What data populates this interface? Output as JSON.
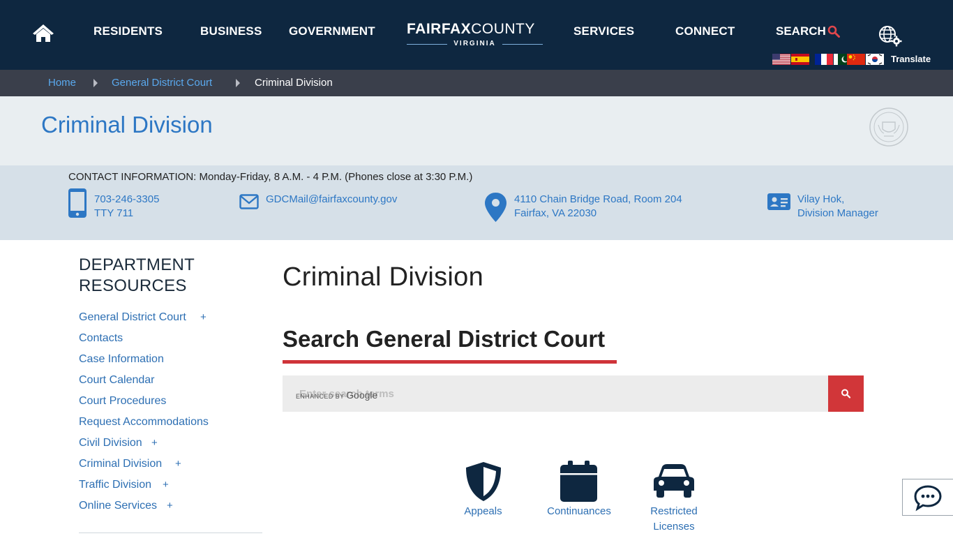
{
  "nav": {
    "residents": "RESIDENTS",
    "business": "BUSINESS",
    "government": "GOVERNMENT",
    "logo_bold": "FAIRFAX",
    "logo_light": "COUNTY",
    "logo_sub": "VIRGINIA",
    "services": "SERVICES",
    "connect": "CONNECT",
    "search": "SEARCH",
    "translate": "Translate"
  },
  "breadcrumb": {
    "home": "Home",
    "parent": "General District Court",
    "current": "Criminal Division"
  },
  "page_heading": "Criminal Division",
  "contact": {
    "hours": "CONTACT INFORMATION: Monday-Friday, 8 A.M. - 4 P.M. (Phones close at 3:30 P.M.)",
    "phone": "703-246-3305",
    "tty": "TTY 711",
    "email": "GDCMail@fairfaxcounty.gov",
    "address_line1": "4110 Chain Bridge Road, Room 204",
    "address_line2": "Fairfax, VA 22030",
    "manager_name": "Vilay Hok,",
    "manager_title": "Division Manager"
  },
  "sidebar": {
    "title": "DEPARTMENT RESOURCES",
    "items": [
      {
        "label": "General District Court",
        "expandable": "+"
      },
      {
        "label": "Contacts",
        "expandable": ""
      },
      {
        "label": "Case Information",
        "expandable": ""
      },
      {
        "label": "Court Calendar",
        "expandable": ""
      },
      {
        "label": "Court Procedures",
        "expandable": ""
      },
      {
        "label": "Request Accommodations",
        "expandable": ""
      },
      {
        "label": "Civil Division",
        "expandable": "+"
      },
      {
        "label": "Criminal Division",
        "expandable": "+"
      },
      {
        "label": "Traffic Division",
        "expandable": "+"
      },
      {
        "label": "Online Services",
        "expandable": "+"
      }
    ]
  },
  "main": {
    "title": "Criminal Division",
    "search_heading": "Search General District Court",
    "search_placeholder": "Enter search terms",
    "google_badge_prefix": "ENHANCED BY",
    "google_badge_brand": "Google",
    "tiles": [
      {
        "label": "Appeals",
        "icon": "shield-icon"
      },
      {
        "label": "Continuances",
        "icon": "calendar-icon"
      },
      {
        "label": "Restricted Licenses",
        "icon": "car-icon"
      }
    ]
  },
  "colors": {
    "nav_bg": "#0e2740",
    "breadcrumb_bg": "#3a3f4b",
    "link_blue": "#2d77c4",
    "accent_red": "#cf3339"
  }
}
